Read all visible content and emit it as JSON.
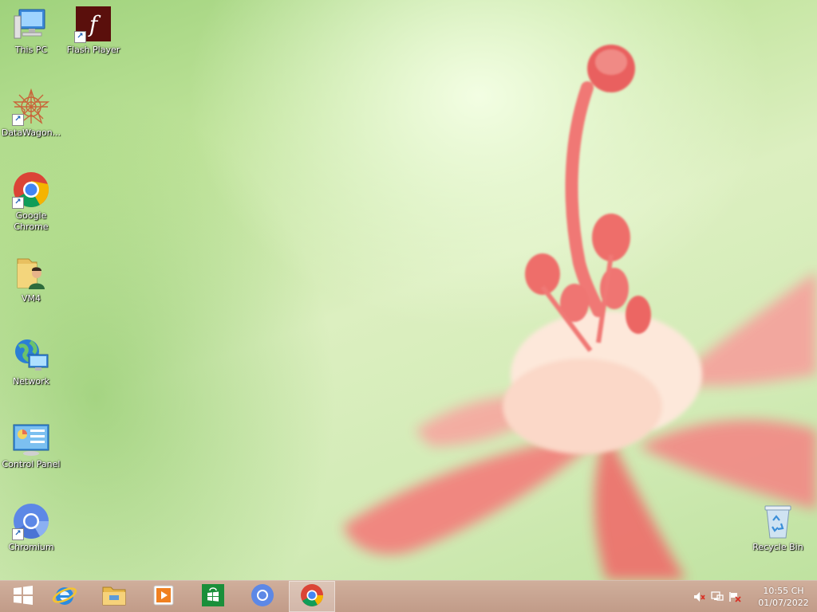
{
  "desktop": {
    "icons": [
      {
        "label": "This PC",
        "icon": "computer-icon"
      },
      {
        "label": "Flash Player",
        "icon": "flash-player-icon"
      },
      {
        "label": "DataWagon...",
        "icon": "datawagon-icon"
      },
      {
        "label": "Google Chrome",
        "icon": "chrome-icon"
      },
      {
        "label": "VM4",
        "icon": "user-folder-icon"
      },
      {
        "label": "Network",
        "icon": "network-icon"
      },
      {
        "label": "Control Panel",
        "icon": "control-panel-icon"
      },
      {
        "label": "Chromium",
        "icon": "chromium-icon"
      },
      {
        "label": "Recycle Bin",
        "icon": "recycle-bin-icon"
      }
    ]
  },
  "taskbar": {
    "pinned": [
      {
        "icon": "windows-start-icon",
        "active": false
      },
      {
        "icon": "internet-explorer-icon",
        "active": false
      },
      {
        "icon": "file-explorer-icon",
        "active": false
      },
      {
        "icon": "media-player-icon",
        "active": false
      },
      {
        "icon": "store-icon",
        "active": false
      },
      {
        "icon": "chromium-icon",
        "active": false
      },
      {
        "icon": "chrome-icon",
        "active": true
      }
    ],
    "tray": {
      "icons": [
        "volume-muted-icon",
        "network-tray-icon",
        "action-center-flag-icon"
      ],
      "time": "10:55 CH",
      "date": "01/07/2022"
    }
  },
  "colors": {
    "taskbar": "#c49a86",
    "wallpaper_green": "#cfeab0",
    "flower_pink": "#f07a78"
  }
}
